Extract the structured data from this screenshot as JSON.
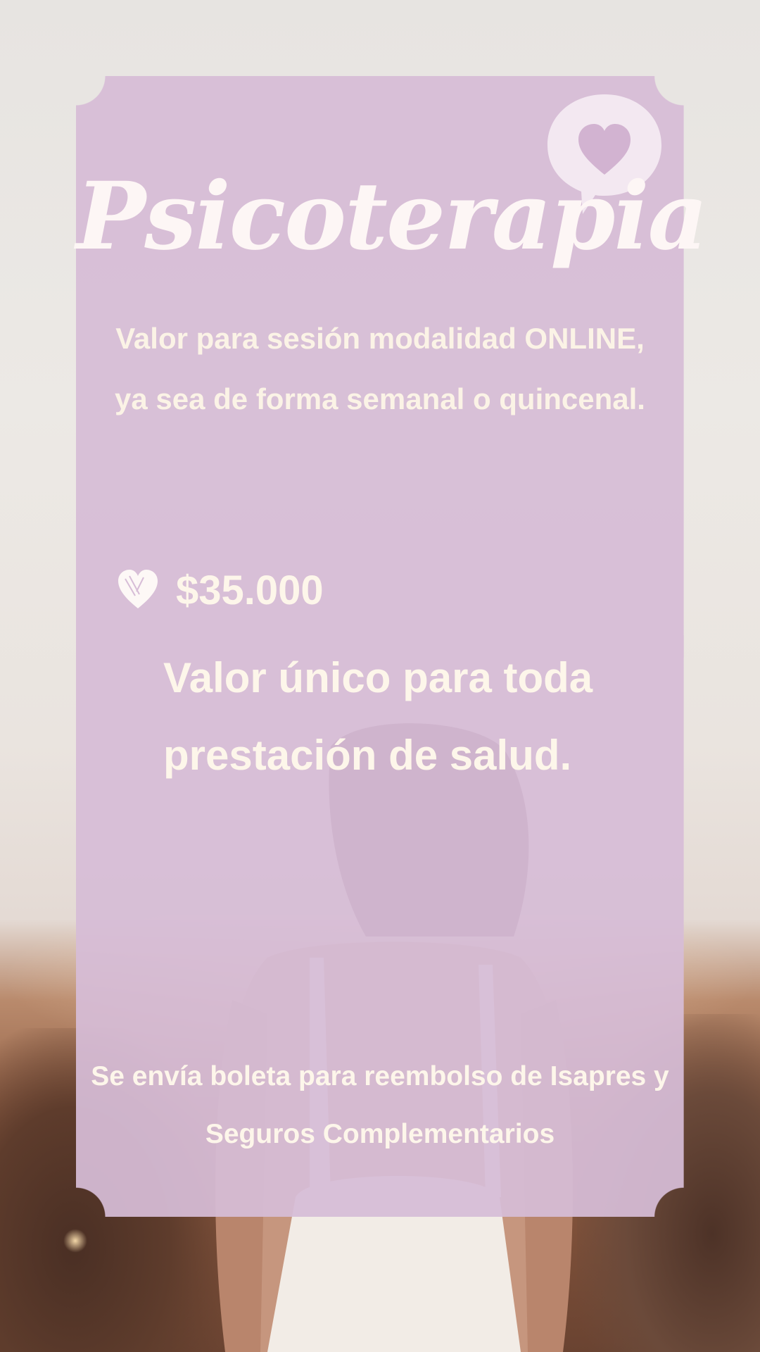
{
  "card": {
    "title": "Psicoterapia",
    "description": "Valor para sesión modalidad ONLINE, ya sea de forma semanal o quincenal.",
    "price": "$35.000",
    "single_value_note": "Valor único para toda prestación de salud.",
    "footer_note": "Se envía boleta para reembolso de Isapres y Seguros Complementarios"
  },
  "icons": {
    "speech_bubble": "speech-bubble-heart-icon",
    "bullet": "heart-icon"
  },
  "colors": {
    "card": "#d7bdd7",
    "text": "#fdf6ea",
    "bubble": "#f3e8f1"
  }
}
